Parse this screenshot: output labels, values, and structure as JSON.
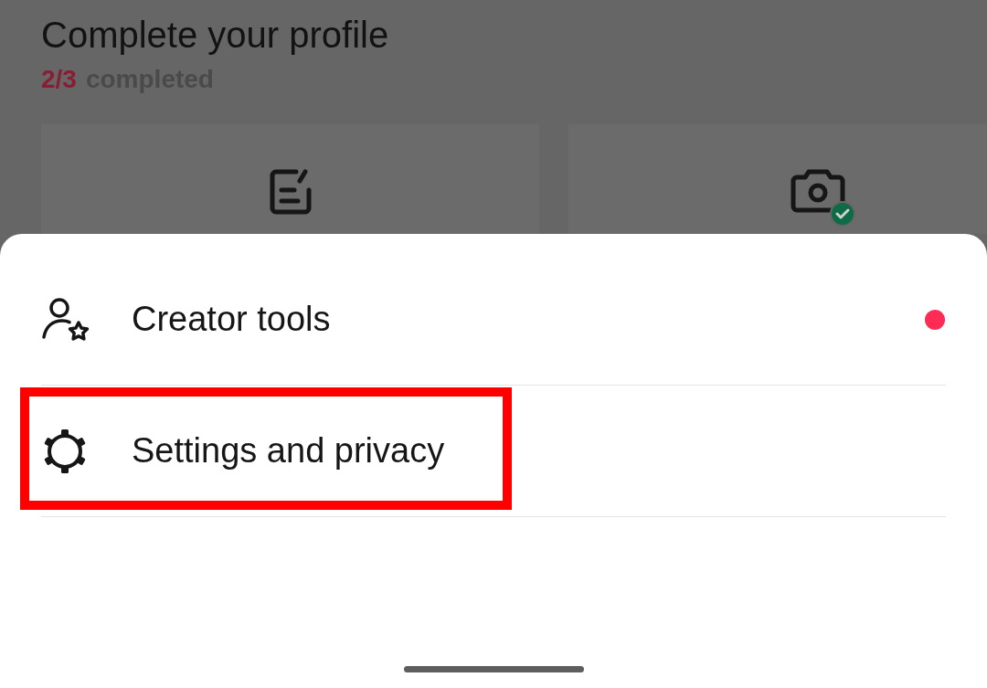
{
  "profile_card": {
    "title": "Complete your profile",
    "progress": {
      "done": "2/3",
      "label": "completed"
    },
    "tasks": [
      {
        "kind": "edit",
        "completed": false
      },
      {
        "kind": "photo",
        "completed": true
      }
    ]
  },
  "menu": {
    "items": [
      {
        "kind": "creator",
        "label": "Creator tools",
        "notification_dot": true,
        "highlighted": false
      },
      {
        "kind": "settings",
        "label": "Settings and privacy",
        "notification_dot": false,
        "highlighted": true
      }
    ]
  }
}
